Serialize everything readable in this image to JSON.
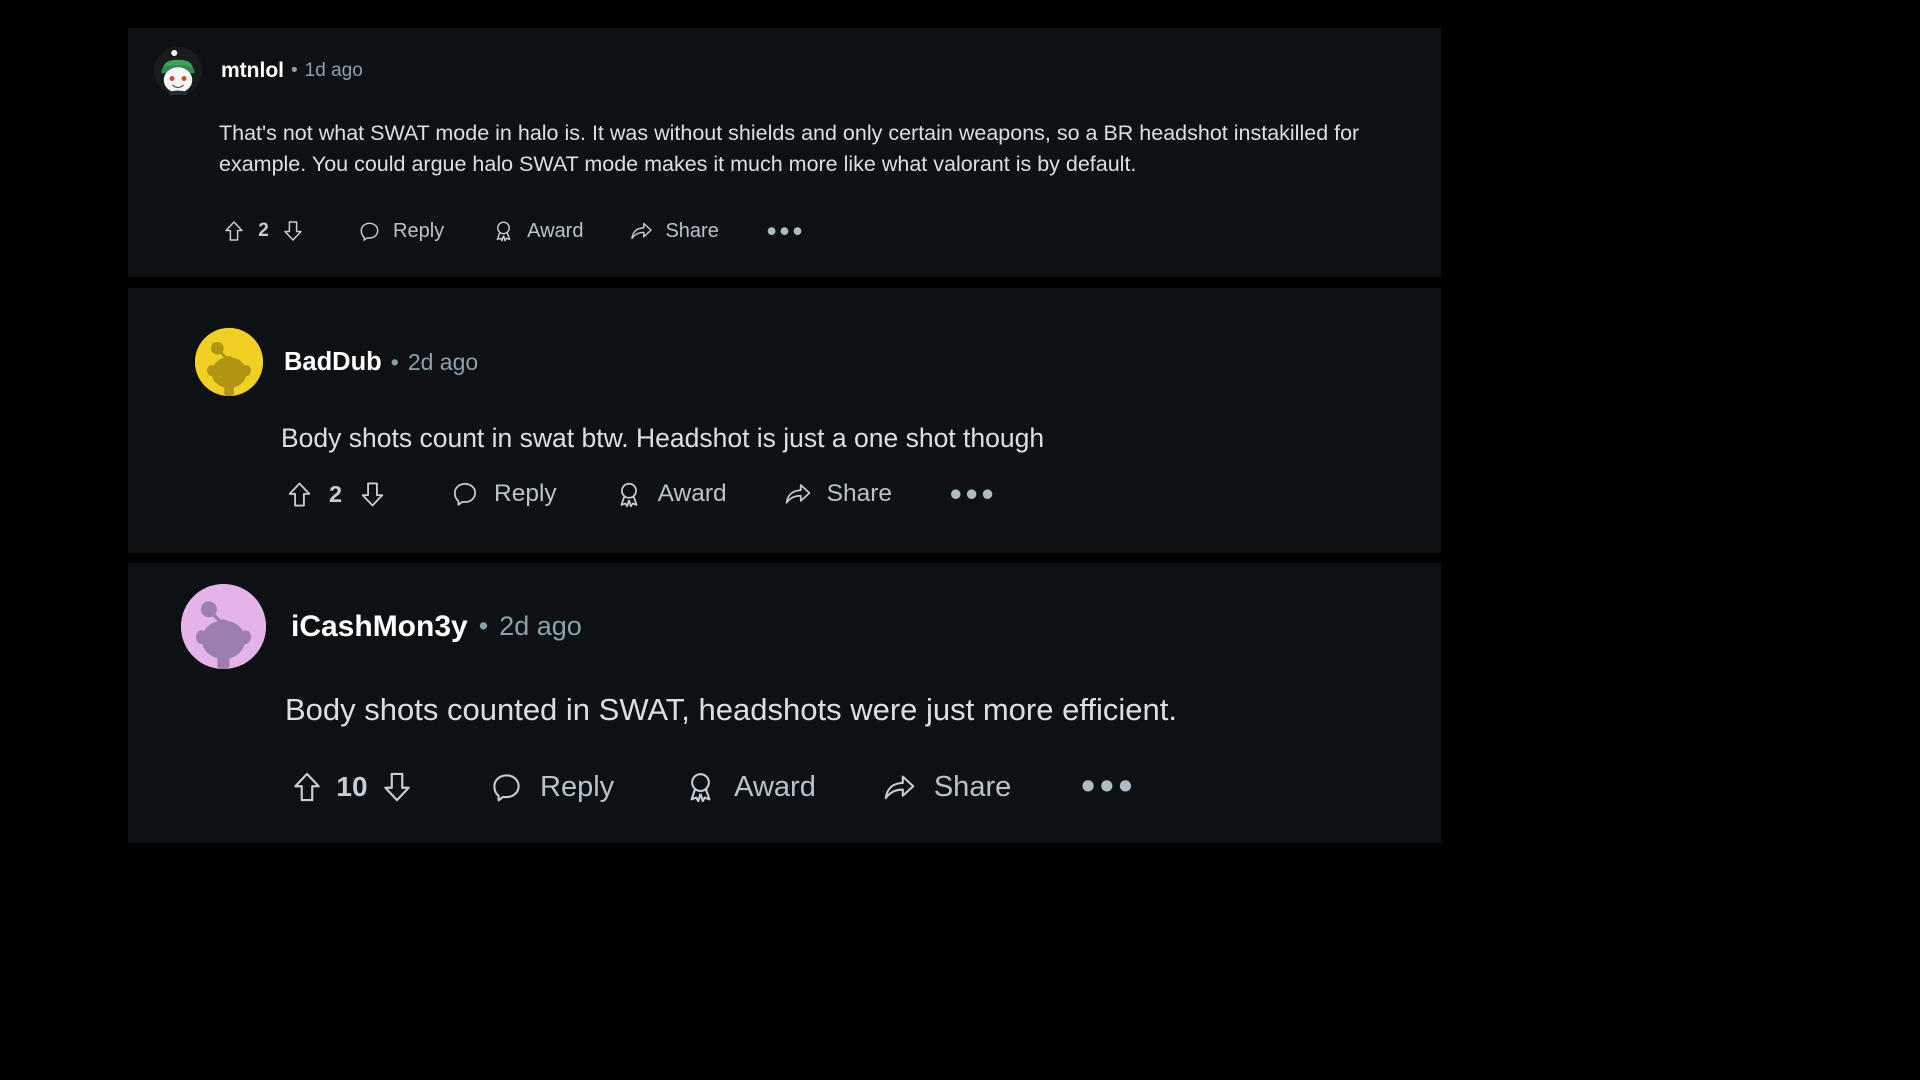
{
  "page": {
    "background_color": "#000000",
    "card_background_color": "#0e1113",
    "body_text_color": "#d8e0e5",
    "muted_text_color": "#8ba2ad",
    "action_text_color": "#b7c4cb"
  },
  "comments": [
    {
      "username": "mtnlol",
      "separator": "•",
      "timestamp": "1d ago",
      "body": "That's not what SWAT mode in halo is. It was without shields and only certain weapons, so a BR headshot instakilled for example. You could argue halo SWAT mode makes it much more like what valorant is by default.",
      "vote_count": "2",
      "upvote_icon": "upvote-arrow-icon",
      "downvote_icon": "downvote-arrow-icon",
      "reply_icon": "comment-bubble-icon",
      "reply_label": "Reply",
      "award_icon": "award-ribbon-icon",
      "award_label": "Award",
      "share_icon": "share-arrow-icon",
      "share_label": "Share",
      "more_label": "•••",
      "avatar": {
        "icon": "reddit-snoo-avatar",
        "body_color": "#f2f2f2",
        "accent_color": "#3ba55d",
        "background_color": "#1b1b1b"
      }
    },
    {
      "username": "BadDub",
      "separator": "•",
      "timestamp": "2d ago",
      "body": "Body shots count in swat btw. Headshot is just a one shot though",
      "vote_count": "2",
      "upvote_icon": "upvote-arrow-icon",
      "downvote_icon": "downvote-arrow-icon",
      "reply_icon": "comment-bubble-icon",
      "reply_label": "Reply",
      "award_icon": "award-ribbon-icon",
      "award_label": "Award",
      "share_icon": "share-arrow-icon",
      "share_label": "Share",
      "more_label": "•••",
      "avatar": {
        "icon": "reddit-snoo-avatar",
        "body_color": "#b09412",
        "accent_color": "#b09412",
        "background_color": "#f2d023"
      }
    },
    {
      "username": "iCashMon3y",
      "separator": "•",
      "timestamp": "2d ago",
      "body": "Body shots counted in SWAT, headshots were just more efficient.",
      "vote_count": "10",
      "upvote_icon": "upvote-arrow-icon",
      "downvote_icon": "downvote-arrow-icon",
      "reply_icon": "comment-bubble-icon",
      "reply_label": "Reply",
      "award_icon": "award-ribbon-icon",
      "award_label": "Award",
      "share_icon": "share-arrow-icon",
      "share_label": "Share",
      "more_label": "•••",
      "avatar": {
        "icon": "reddit-snoo-avatar",
        "body_color": "#9a7fb0",
        "accent_color": "#9a7fb0",
        "background_color": "#e5b3ea"
      }
    }
  ]
}
